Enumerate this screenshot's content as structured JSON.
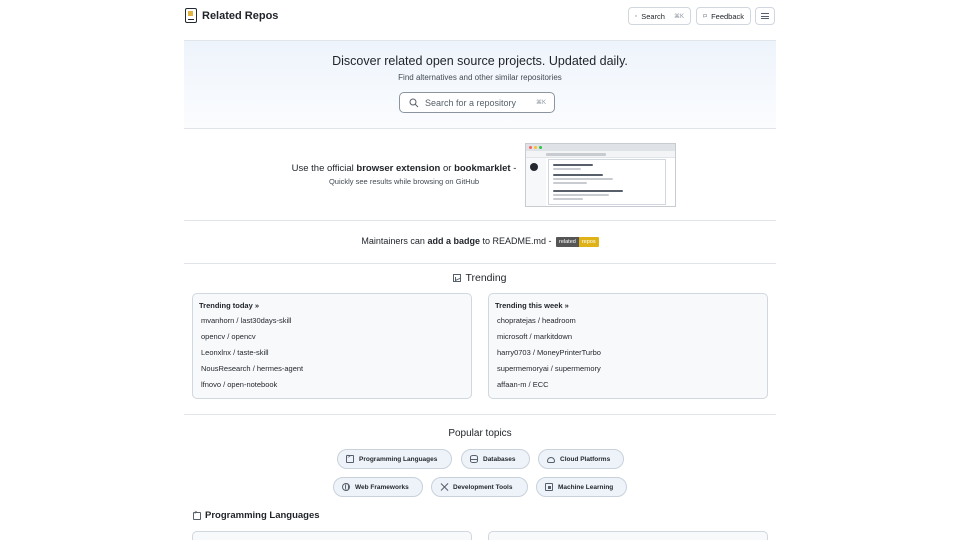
{
  "header": {
    "brand": "Related Repos",
    "search_label": "Search",
    "search_kbd": "⌘K",
    "feedback_label": "Feedback"
  },
  "hero": {
    "title": "Discover related open source projects. Updated daily.",
    "subtitle": "Find alternatives and other similar repositories",
    "search_placeholder": "Search for a repository",
    "search_kbd": "⌘K"
  },
  "extension": {
    "prefix": "Use the official ",
    "extension_link": "browser extension",
    "middle": " or ",
    "bookmarklet_link": "bookmarklet",
    "suffix": " -",
    "subtitle": "Quickly see results while browsing on GitHub"
  },
  "badge": {
    "prefix": "Maintainers can ",
    "link": "add a badge",
    "suffix": " to README.md -",
    "left": "related",
    "right": "repos"
  },
  "trending": {
    "title": "Trending",
    "today": {
      "heading": "Trending today »",
      "items": [
        "mvanhorn / last30days-skill",
        "opencv / opencv",
        "Leonxlnx / taste-skill",
        "NousResearch / hermes-agent",
        "lfnovo / open-notebook"
      ]
    },
    "week": {
      "heading": "Trending this week »",
      "items": [
        "chopratejas / headroom",
        "microsoft / markitdown",
        "harry0703 / MoneyPrinterTurbo",
        "supermemoryai / supermemory",
        "affaan-m / ECC"
      ]
    }
  },
  "topics": {
    "title": "Popular topics",
    "chips": [
      {
        "label": "Programming Languages",
        "icon": "terminal-icon"
      },
      {
        "label": "Databases",
        "icon": "database-icon"
      },
      {
        "label": "Cloud Platforms",
        "icon": "cloud-icon"
      },
      {
        "label": "Web Frameworks",
        "icon": "globe-icon"
      },
      {
        "label": "Development Tools",
        "icon": "tools-icon"
      },
      {
        "label": "Machine Learning",
        "icon": "chip-icon"
      }
    ]
  },
  "section": {
    "title": "Programming Languages"
  },
  "colors": {
    "accent": "#0969da",
    "badge_right": "#dfb317",
    "hero_bg": "#eef4fc"
  }
}
